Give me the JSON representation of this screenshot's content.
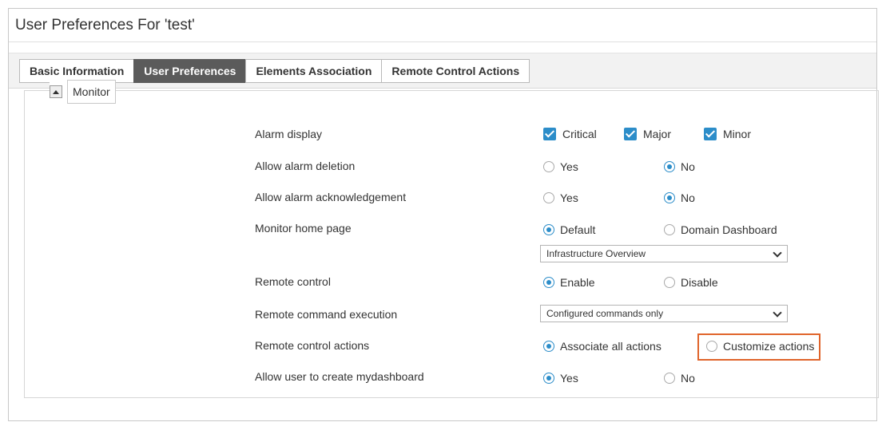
{
  "panel": {
    "title": "User Preferences For 'test'"
  },
  "tabs": [
    {
      "label": "Basic Information",
      "active": false
    },
    {
      "label": "User Preferences",
      "active": true
    },
    {
      "label": "Elements Association",
      "active": false
    },
    {
      "label": "Remote Control Actions",
      "active": false
    }
  ],
  "section": {
    "legend": "Monitor",
    "collapsed": false
  },
  "rows": {
    "alarm_display": {
      "label": "Alarm display",
      "options": [
        "Critical",
        "Major",
        "Minor"
      ],
      "checked": [
        true,
        true,
        true
      ]
    },
    "allow_alarm_deletion": {
      "label": "Allow alarm deletion",
      "options": [
        "Yes",
        "No"
      ],
      "selected": "No"
    },
    "allow_alarm_ack": {
      "label": "Allow alarm acknowledgement",
      "options": [
        "Yes",
        "No"
      ],
      "selected": "No"
    },
    "monitor_home_page": {
      "label": "Monitor home page",
      "options": [
        "Default",
        "Domain Dashboard"
      ],
      "selected": "Default",
      "dropdown_value": "Infrastructure Overview"
    },
    "remote_control": {
      "label": "Remote control",
      "options": [
        "Enable",
        "Disable"
      ],
      "selected": "Enable"
    },
    "remote_command_execution": {
      "label": "Remote command execution",
      "dropdown_value": "Configured commands only"
    },
    "remote_control_actions": {
      "label": "Remote control actions",
      "options": [
        "Associate all actions",
        "Customize actions"
      ],
      "selected": "Associate all actions"
    },
    "allow_mydashboard": {
      "label": "Allow user to create mydashboard",
      "options": [
        "Yes",
        "No"
      ],
      "selected": "Yes"
    }
  },
  "colors": {
    "accent": "#2c8dc9",
    "highlight": "#e0642b",
    "active_tab": "#5b5b5b"
  }
}
